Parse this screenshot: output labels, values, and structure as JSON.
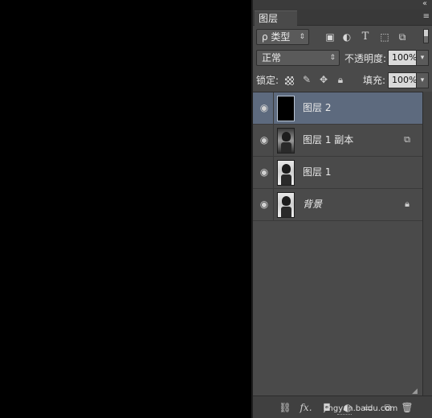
{
  "panel": {
    "tab_label": "图层",
    "collapse_glyph": "‹‹",
    "menu_glyph": "≡"
  },
  "filter": {
    "kind_label": "ρ 类型",
    "icons": [
      "image-filter-icon",
      "adjustment-filter-icon",
      "type-filter-icon",
      "shape-filter-icon",
      "smart-object-filter-icon"
    ]
  },
  "blending": {
    "mode": "正常",
    "opacity_label": "不透明度:",
    "opacity_value": "100%"
  },
  "lock": {
    "label": "锁定:",
    "fill_label": "填充:",
    "fill_value": "100%"
  },
  "layers": [
    {
      "name": "图层 2",
      "selected": true,
      "thumb": "black",
      "badge": ""
    },
    {
      "name": "图层 1 副本",
      "selected": false,
      "thumb": "photo-dark",
      "badge": "smart-object-icon"
    },
    {
      "name": "图层 1",
      "selected": false,
      "thumb": "photo",
      "badge": ""
    },
    {
      "name": "背景",
      "selected": false,
      "thumb": "photo",
      "badge": "lock-icon"
    }
  ],
  "footer": {
    "watermark": "jingyan.baidu.com",
    "fx_label": "fx."
  }
}
